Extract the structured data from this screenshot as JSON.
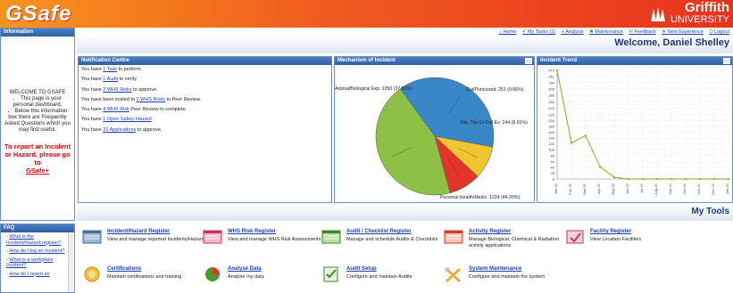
{
  "header": {
    "brand": "GSafe",
    "university_line1": "Griffith",
    "university_line2": "UNIVERSITY"
  },
  "info": {
    "title": "Information",
    "welcome": "WELCOME TO GSAFE",
    "bullets": [
      "This page is your personal dashboard.",
      "Below this information box there are Frequently Asked Questions which you may find useful."
    ],
    "report_text": "To report an Incident or Hazard, please go to",
    "report_link": "GSafe+"
  },
  "faq": {
    "title": "FAQ",
    "items": [
      "What is the Incident/Hazard register?",
      "How do I log an Incident?",
      "What is a workplace Incident?",
      "How do I report an"
    ]
  },
  "toplinks": [
    "Home",
    "My Tasks (1)",
    "Analysis",
    "Maintenance",
    "Feedback",
    "New Experience",
    "Logout"
  ],
  "welcome_text": "Welcome, Daniel Shelley",
  "notification": {
    "title": "Notification Centre",
    "lines": [
      {
        "pre": "You have ",
        "link": "1 Task",
        "post": " to perform"
      },
      {
        "pre": "You have ",
        "link": "1 Audit",
        "post": " to verify."
      },
      {
        "pre": "You have ",
        "link": "2 WHS Risks",
        "post": " to approve."
      },
      {
        "pre": "You have been invited to ",
        "link": "2 WHS Risks",
        "post": " to Peer Review."
      },
      {
        "pre": "You have ",
        "link": "4 WHS Risk",
        "post": " Peer Review to complete."
      },
      {
        "pre": "You have ",
        "link": "1 Open Safety Hazard",
        "post": "."
      },
      {
        "pre": "You have ",
        "link": "20 Applications",
        "post": " to approve."
      }
    ]
  },
  "mechanism": {
    "title": "Mechanism of Incident"
  },
  "trend": {
    "title": "Incident Trend"
  },
  "chart_data": [
    {
      "type": "pie",
      "title": "Mechanism of Incident",
      "labels": [
        "Animal/Biological Exp",
        "Cut/Punctured",
        "Slip, Trip Or Fall Ev",
        "Personal Health/Medic"
      ],
      "values": [
        1050,
        251,
        244,
        1224
      ],
      "percents": [
        "37.92%",
        "9.06%",
        "8.81%",
        "44.20%"
      ],
      "display_labels": [
        "Animal/Biological Exp: 1050 (37.92%)",
        "Cut/Punctured: 251 (9.06%)",
        "Slip, Trip Or Fall Ev: 244 (8.81%)",
        "Personal Health/Medic: 1224 (44.20%)"
      ],
      "colors": [
        "#3a87c8",
        "#f0c531",
        "#e3342a",
        "#8dc044"
      ]
    },
    {
      "type": "line",
      "title": "Incident Trend",
      "categories": [
        "Jan-22",
        "Feb-22",
        "Mar-22",
        "Apr-22",
        "May-22",
        "Jun-22",
        "Jul-22",
        "Aug-22",
        "Sep-22",
        "Oct-22",
        "Nov-22",
        "Dec-22",
        "Jan-23"
      ],
      "values": [
        372,
        124,
        148,
        42,
        6,
        0,
        0,
        0,
        0,
        0,
        0,
        0,
        0
      ],
      "yticks": [
        0,
        20,
        40,
        60,
        80,
        100,
        120,
        140,
        160,
        180,
        200,
        220,
        242,
        264,
        286,
        308,
        330,
        351,
        372
      ],
      "ylim": [
        0,
        372
      ],
      "color": "#8dc044",
      "grid": true
    }
  ],
  "tools": {
    "title": "My Tools",
    "items": [
      {
        "title": "Incident/Hazard Register",
        "desc": "View and manage reported Incidents/Hazards",
        "icon": "register-icon"
      },
      {
        "title": "WHS Risk Register",
        "desc": "View and manage WHS Risk Assessments",
        "icon": "risk-register-icon"
      },
      {
        "title": "Audit / Checklist Register",
        "desc": "Manage and schedule Audits & Checklists",
        "icon": "audit-register-icon"
      },
      {
        "title": "Activity Register",
        "desc": "Manage Biological, Chemical & Radiation activity applications",
        "icon": "activity-register-icon"
      },
      {
        "title": "Facility Register",
        "desc": "View Location Facilities",
        "icon": "facility-icon"
      },
      {
        "title": "Certifications",
        "desc": "Maintain certifications and training",
        "icon": "certificate-icon"
      },
      {
        "title": "Analyse Data",
        "desc": "Analyse my data",
        "icon": "analyse-icon"
      },
      {
        "title": "Audit Setup",
        "desc": "Configure and maintain Audits",
        "icon": "audit-setup-icon"
      },
      {
        "title": "System Maintenance",
        "desc": "Configure and maintain the system",
        "icon": "maintenance-icon"
      }
    ]
  }
}
